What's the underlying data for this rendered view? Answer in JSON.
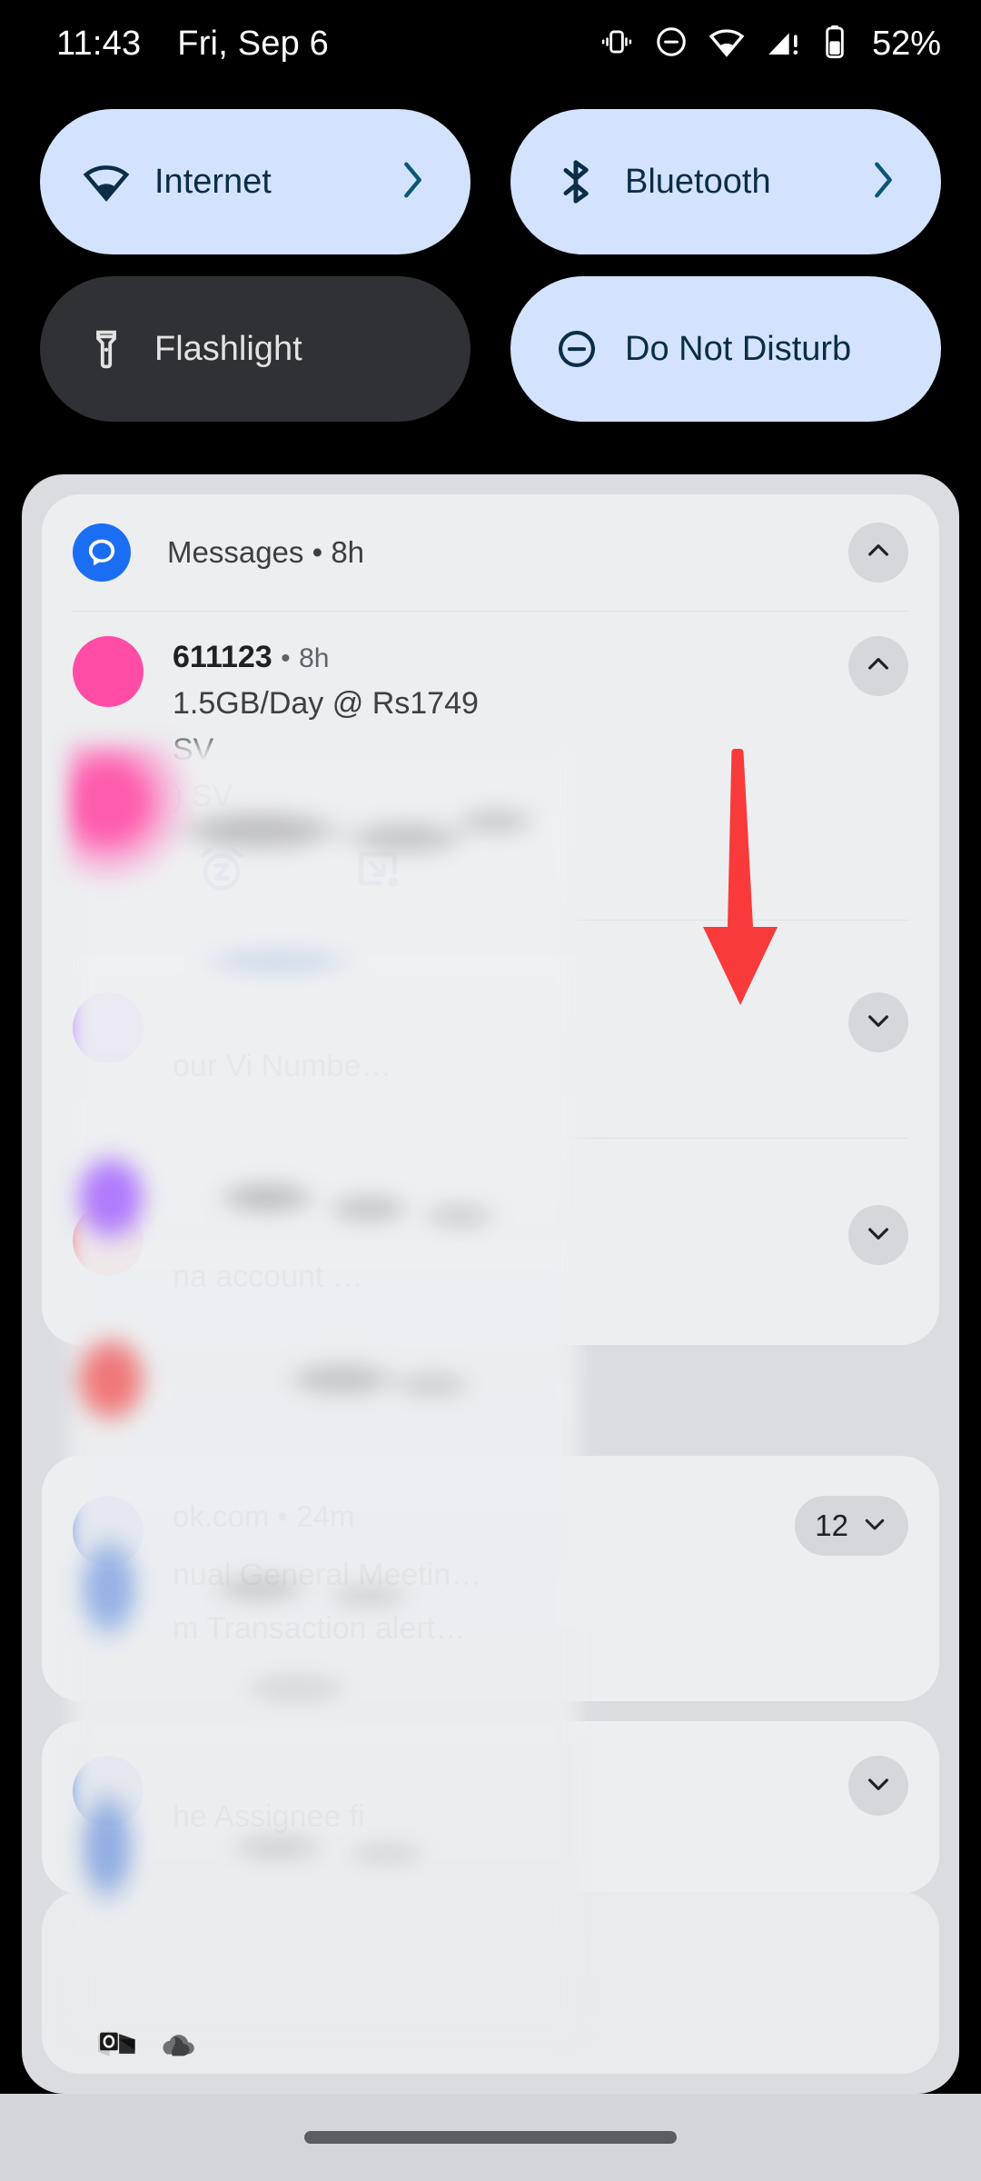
{
  "status_bar": {
    "time": "11:43",
    "date": "Fri, Sep 6",
    "battery_percent": "52%",
    "icons": [
      "vibrate-icon",
      "do-not-disturb-icon",
      "wifi-icon",
      "cellular-signal-warning-icon",
      "battery-icon"
    ]
  },
  "quick_settings": {
    "tiles": [
      {
        "label": "Internet",
        "icon": "wifi-icon",
        "state": "on",
        "has_chevron": true,
        "accent": "#d3e3fd",
        "fg": "#0b2d48"
      },
      {
        "label": "Bluetooth",
        "icon": "bluetooth-icon",
        "state": "on",
        "has_chevron": true,
        "accent": "#d3e3fd",
        "fg": "#0b2d48"
      },
      {
        "label": "Flashlight",
        "icon": "flashlight-icon",
        "state": "off",
        "has_chevron": false,
        "accent": "#303134",
        "fg": "#e3e3e3"
      },
      {
        "label": "Do Not Disturb",
        "icon": "do-not-disturb-icon",
        "state": "on",
        "has_chevron": false,
        "accent": "#d3e3fd",
        "fg": "#0b2d48"
      }
    ]
  },
  "shade": {
    "messages_group": {
      "app_name": "Messages",
      "separator": "•",
      "time": "8h",
      "app_icon": "messages-icon",
      "expander_icon": "chevron-up-icon",
      "notifications": [
        {
          "sender": "611123",
          "separator": "•",
          "time": "8h",
          "lines": [
            "1.5GB/Day @ Rs1749",
            "SV",
            ") SV"
          ],
          "avatar_color": "#ff4da6",
          "expander_icon": "chevron-up-icon",
          "actions": [
            {
              "name": "snooze-button",
              "icon": "snooze-alarm-icon",
              "color": "#15659f"
            },
            {
              "name": "bubble-button",
              "icon": "bubble-minimize-icon",
              "color": "#15659f"
            }
          ]
        },
        {
          "sender": "",
          "time": "",
          "lines": [
            "our Vi Numbe…"
          ],
          "avatar_color": "#aa6eff",
          "expander_icon": "chevron-down-icon",
          "actions": []
        },
        {
          "sender": "",
          "time": "",
          "lines": [
            "na account …"
          ],
          "avatar_color": "#f06464",
          "expander_icon": "chevron-down-icon",
          "actions": []
        }
      ]
    },
    "outlook_group": {
      "app_name": "ok.com",
      "separator": "•",
      "time": "24m",
      "badge_count": "12",
      "expander_icon": "chevron-down-icon",
      "lines": [
        "nual General Meetin…",
        "m Transaction alert…"
      ],
      "avatar_color": "#5082dc"
    },
    "last_group": {
      "line": "he Assignee fi",
      "expander_icon": "chevron-down-icon",
      "avatar_color": "#4678d7"
    },
    "silent_section": {
      "app_icons": [
        "outlook-icon",
        "onedrive-icon"
      ]
    }
  },
  "annotation": {
    "arrow_color": "#f93a3a",
    "points_to": "snooze-button"
  },
  "navigation": {
    "gesture_pill": "home-gesture-pill"
  }
}
